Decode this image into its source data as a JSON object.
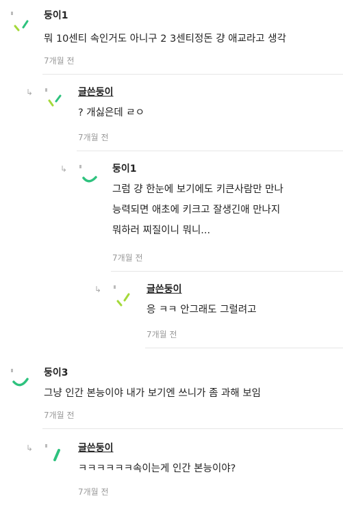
{
  "comments": [
    {
      "author": "둥이1",
      "body_lines": [
        "뭐 10센티 속인거도 아니구 2 3센티정돈 걍 애교라고 생각"
      ],
      "time": "7개월 전"
    },
    {
      "author": "글쓴둥이",
      "body_lines": [
        "? 개싫은데 ㄹㅇ"
      ],
      "time": "7개월 전"
    },
    {
      "author": "둥이1",
      "body_lines": [
        "그럼 걍 한눈에 보기에도 키큰사람만 만나",
        "능력되면 애초에 키크고 잘생긴애 만나지",
        "뭐하러 찌질이니 뭐니..."
      ],
      "time": "7개월 전"
    },
    {
      "author": "글쓴둥이",
      "body_lines": [
        "응 ㅋㅋ 안그래도 그럴려고"
      ],
      "time": "7개월 전"
    },
    {
      "author": "둥이3",
      "body_lines": [
        "그냥 인간 본능이야 내가 보기엔 쓰니가 좀 과해 보임"
      ],
      "time": "7개월 전"
    },
    {
      "author": "글쓴둥이",
      "body_lines": [
        "ㅋㅋㅋㅋㅋㅋ속이는게 인간 본능이야?"
      ],
      "time": "7개월 전"
    }
  ],
  "icons": {
    "reply": "reply-arrow-icon",
    "avatar": "avatar-icon"
  },
  "colors": {
    "lime": "#a4d93a",
    "green": "#2ec27e",
    "meta": "#999999"
  }
}
